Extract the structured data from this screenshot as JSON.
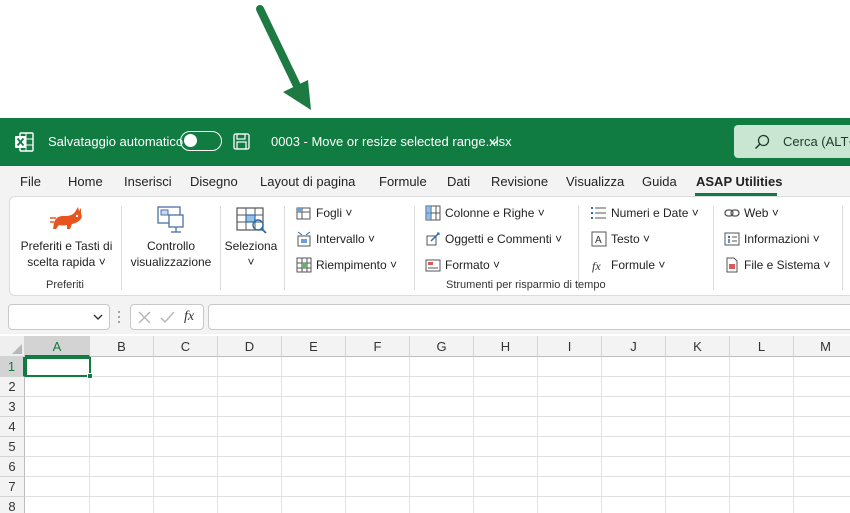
{
  "titlebar": {
    "autosave_label": "Salvataggio automatico",
    "autosave_state": "off",
    "filename": "0003 - Move or resize selected range.xlsx",
    "search_label": "Cerca (ALT+",
    "app_icon": "excel-icon",
    "accent_color": "#107c41"
  },
  "tabs": [
    {
      "label": "File"
    },
    {
      "label": "Home"
    },
    {
      "label": "Inserisci"
    },
    {
      "label": "Disegno"
    },
    {
      "label": "Layout di pagina"
    },
    {
      "label": "Formule"
    },
    {
      "label": "Dati"
    },
    {
      "label": "Revisione"
    },
    {
      "label": "Visualizza"
    },
    {
      "label": "Guida"
    },
    {
      "label": "ASAP Utilities",
      "active": true
    }
  ],
  "ribbon": {
    "preferiti": {
      "button_line1": "Preferiti e Tasti di",
      "button_line2": "scelta rapida",
      "group_label": "Preferiti",
      "icon": "rabbit-icon"
    },
    "controllo": {
      "line1": "Controllo",
      "line2": "visualizzazione",
      "icon": "monitor-icon"
    },
    "seleziona": {
      "label": "Seleziona",
      "icon": "select-range-icon"
    },
    "tools": {
      "group_label": "Strumenti per risparmio di tempo",
      "col1": [
        {
          "label": "Fogli",
          "icon": "sheets-icon"
        },
        {
          "label": "Intervallo",
          "icon": "range-icon"
        },
        {
          "label": "Riempimento",
          "icon": "fill-icon"
        }
      ],
      "col2": [
        {
          "label": "Colonne e Righe",
          "icon": "columns-rows-icon"
        },
        {
          "label": "Oggetti e Commenti",
          "icon": "objects-icon"
        },
        {
          "label": "Formato",
          "icon": "format-icon"
        }
      ],
      "col3": [
        {
          "label": "Numeri e Date",
          "icon": "numbers-icon"
        },
        {
          "label": "Testo",
          "icon": "text-icon"
        },
        {
          "label": "Formule",
          "icon": "fx-icon"
        }
      ],
      "col4": [
        {
          "label": "Web",
          "icon": "link-icon"
        },
        {
          "label": "Informazioni",
          "icon": "info-icon"
        },
        {
          "label": "File e Sistema",
          "icon": "file-icon"
        }
      ]
    }
  },
  "formula_bar": {
    "namebox_value": "",
    "formula_value": "",
    "fx_label": "fx"
  },
  "grid": {
    "columns": [
      "A",
      "B",
      "C",
      "D",
      "E",
      "F",
      "G",
      "H",
      "I",
      "J",
      "K",
      "L",
      "M"
    ],
    "rows": [
      "1",
      "2",
      "3",
      "4",
      "5",
      "6",
      "7",
      "8"
    ],
    "selected_cell": "A1"
  }
}
